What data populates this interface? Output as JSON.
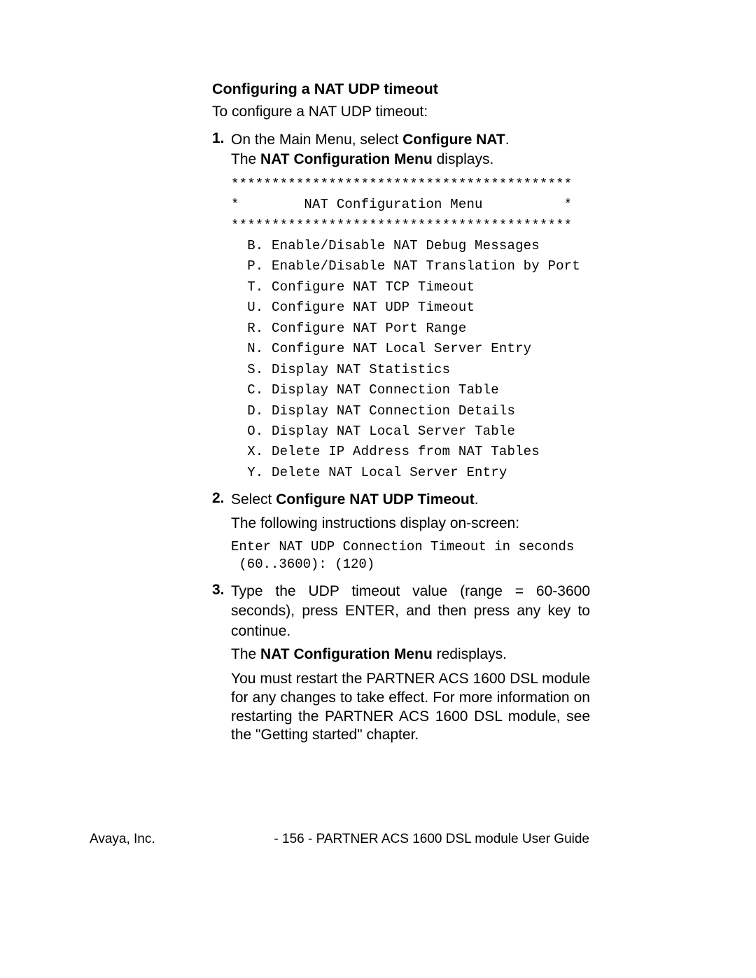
{
  "header": {
    "title": "Configuring a NAT UDP timeout",
    "intro": "To configure a NAT UDP timeout:"
  },
  "steps": {
    "s1": {
      "num": "1.",
      "text_a": "On the Main Menu, select ",
      "text_b_bold": "Configure NAT",
      "text_c": ".",
      "line2_a": "The ",
      "line2_b_bold": "NAT Configuration Menu",
      "line2_c": " displays."
    },
    "s2": {
      "num": "2.",
      "text_a": "Select ",
      "text_b_bold": "Configure NAT UDP Timeout",
      "text_c": ".",
      "para": "The following instructions display on-screen:"
    },
    "s3": {
      "num": "3.",
      "text": "Type the UDP timeout value (range = 60-3600 seconds), press ENTER, and then press any key to continue.",
      "para_a": "The ",
      "para_b_bold": "NAT Configuration Menu",
      "para_c": " redisplays.",
      "para2": "You must restart the PARTNER ACS 1600 DSL module for any changes to take effect.  For more information on restarting the PARTNER ACS 1600 DSL module, see the \"Getting started\" chapter."
    }
  },
  "menu_block": "******************************************\n*        NAT Configuration Menu          *\n******************************************\n  B. Enable/Disable NAT Debug Messages\n  P. Enable/Disable NAT Translation by Port\n  T. Configure NAT TCP Timeout\n  U. Configure NAT UDP Timeout\n  R. Configure NAT Port Range\n  N. Configure NAT Local Server Entry\n  S. Display NAT Statistics\n  C. Display NAT Connection Table\n  D. Display NAT Connection Details\n  O. Display NAT Local Server Table\n  X. Delete IP Address from NAT Tables\n  Y. Delete NAT Local Server Entry",
  "prompt_block": "Enter NAT UDP Connection Timeout in seconds\n (60..3600): (120)",
  "footer": {
    "left": "Avaya, Inc.",
    "right": "- 156 - PARTNER ACS 1600 DSL module User Guide"
  }
}
